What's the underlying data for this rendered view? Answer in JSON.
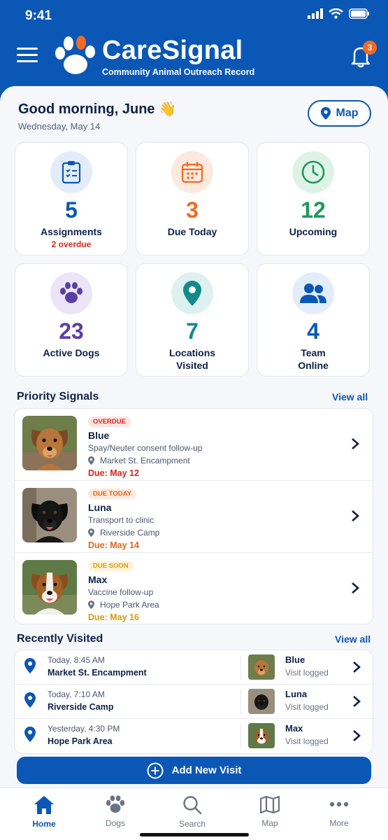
{
  "status_bar": {
    "time": "9:41"
  },
  "header": {
    "app_name": "CareSignal",
    "subtitle": "Community Animal Outreach Record",
    "notification_count": "3"
  },
  "greeting": {
    "text": "Good morning, June 👋",
    "date": "Wednesday, May 14",
    "map_label": "Map"
  },
  "stats": [
    {
      "value": "5",
      "label": "Assignments",
      "sub": "2 overdue",
      "color": "#0b57b5",
      "bg": "#e3edfa",
      "icon": "clipboard-icon"
    },
    {
      "value": "3",
      "label": "Due Today",
      "sub": "",
      "color": "#f26a21",
      "bg": "#fde9dd",
      "icon": "calendar-icon"
    },
    {
      "value": "12",
      "label": "Upcoming",
      "sub": "",
      "color": "#1e9a5a",
      "bg": "#dff2e7",
      "icon": "clock-icon"
    },
    {
      "value": "23",
      "label": "Active Dogs",
      "sub": "",
      "color": "#5a3ea6",
      "bg": "#ece5f7",
      "icon": "paw-icon"
    },
    {
      "value": "7",
      "label": "Locations Visited",
      "sub": "",
      "color": "#138a8a",
      "bg": "#dcf1f0",
      "icon": "location-pin-icon"
    },
    {
      "value": "4",
      "label": "Team Online",
      "sub": "",
      "color": "#0b57b5",
      "bg": "#e3edfa",
      "icon": "team-icon"
    }
  ],
  "priority": {
    "title": "Priority Signals",
    "view_all": "View all",
    "items": [
      {
        "tag": "OVERDUE",
        "tag_color": "#d7261e",
        "tag_bg": "#fde3e1",
        "name": "Blue",
        "task": "Spay/Neuter consent follow-up",
        "location": "Market St. Encampment",
        "due": "Due: May 12",
        "due_color": "#d7261e"
      },
      {
        "tag": "DUE TODAY",
        "tag_color": "#e0661c",
        "tag_bg": "#fde9dd",
        "name": "Luna",
        "task": "Transport to clinic",
        "location": "Riverside Camp",
        "due": "Due: May 14",
        "due_color": "#e0661c"
      },
      {
        "tag": "DUE SOON",
        "tag_color": "#d89a0e",
        "tag_bg": "#fdf3d8",
        "name": "Max",
        "task": "Vaccine follow-up",
        "location": "Hope Park Area",
        "due": "Due: May 16",
        "due_color": "#d89a0e"
      }
    ]
  },
  "recent": {
    "title": "Recently Visited",
    "view_all": "View all",
    "items": [
      {
        "time": "Today, 8:45 AM",
        "place": "Market St. Encampment",
        "dog": "Blue",
        "status": "Visit logged"
      },
      {
        "time": "Today, 7:10 AM",
        "place": "Riverside Camp",
        "dog": "Luna",
        "status": "Visit logged"
      },
      {
        "time": "Yesterday, 4:30 PM",
        "place": "Hope Park Area",
        "dog": "Max",
        "status": "Visit logged"
      }
    ]
  },
  "add_visit_label": "Add New Visit",
  "nav": [
    {
      "label": "Home",
      "icon": "home-icon",
      "active": true
    },
    {
      "label": "Dogs",
      "icon": "paw-icon",
      "active": false
    },
    {
      "label": "Search",
      "icon": "search-icon",
      "active": false
    },
    {
      "label": "Map",
      "icon": "map-icon",
      "active": false
    },
    {
      "label": "More",
      "icon": "more-icon",
      "active": false
    }
  ]
}
